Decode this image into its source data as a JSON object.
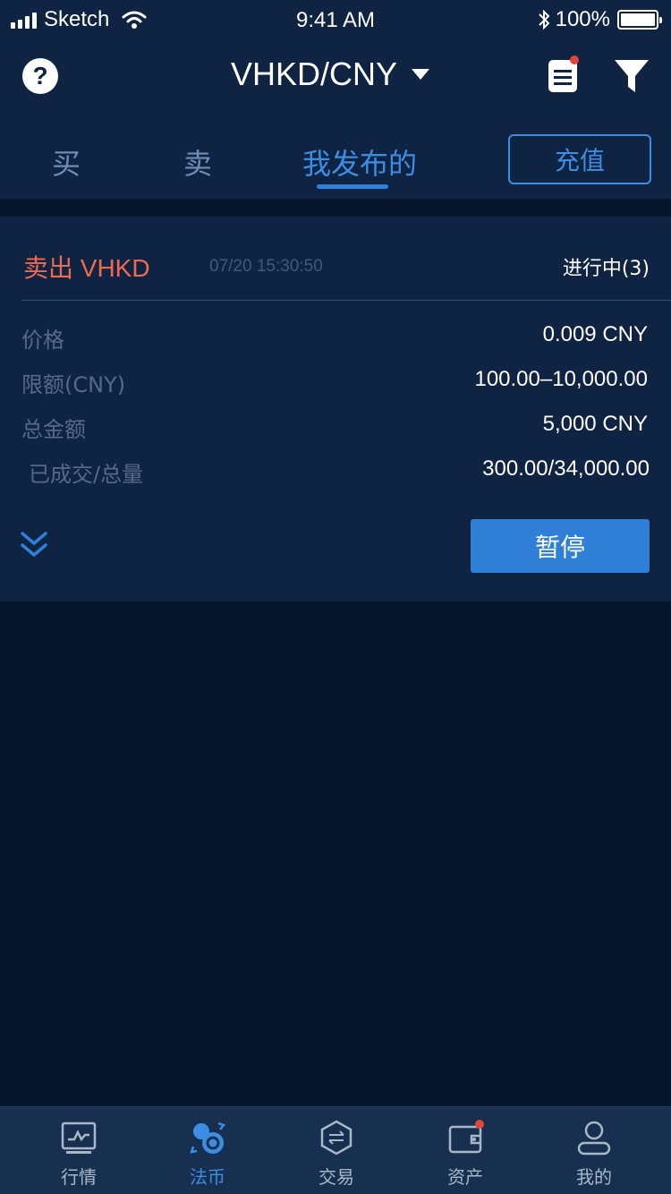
{
  "status_bar": {
    "carrier": "Sketch",
    "time": "9:41 AM",
    "battery": "100%",
    "bluetooth_icon": "bluetooth-icon",
    "wifi_icon": "wifi-icon"
  },
  "nav": {
    "title": "VHKD/CNY",
    "help_icon": "question-circle-icon",
    "help_glyph": "?",
    "orders_icon": "document-list-icon",
    "filter_icon": "filter-funnel-icon",
    "notification_dot_color": "#e5443b"
  },
  "tabs": {
    "items": [
      {
        "label": "买"
      },
      {
        "label": "卖"
      },
      {
        "label": "我发布的",
        "active": true
      }
    ],
    "recharge_label": "充值"
  },
  "order_card": {
    "title": "卖出 VHKD",
    "time": "07/20 15:30:50",
    "status": "进行中(3)",
    "rows": [
      {
        "label": "价格",
        "value": "0.009 CNY"
      },
      {
        "label": "限额(CNY)",
        "value": "100.00–10,000.00"
      },
      {
        "label": "总金额",
        "value": "5,000 CNY"
      },
      {
        "label": "已成交/总量",
        "value": "300.00/34,000.00"
      }
    ],
    "expand_icon": "double-chevron-down-icon",
    "pause_label": "暂停"
  },
  "bottom_tabs": [
    {
      "label": "行情",
      "icon": "chart-monitor-icon"
    },
    {
      "label": "法币",
      "icon": "currency-exchange-icon",
      "active": true
    },
    {
      "label": "交易",
      "icon": "hexagon-swap-icon"
    },
    {
      "label": "资产",
      "icon": "wallet-icon",
      "badge": true
    },
    {
      "label": "我的",
      "icon": "user-profile-icon"
    }
  ],
  "colors": {
    "background": "#08162b",
    "panel": "#0f2342",
    "accent": "#3e8de4",
    "sell": "#ef6a4f",
    "tabbar": "#17304f"
  }
}
